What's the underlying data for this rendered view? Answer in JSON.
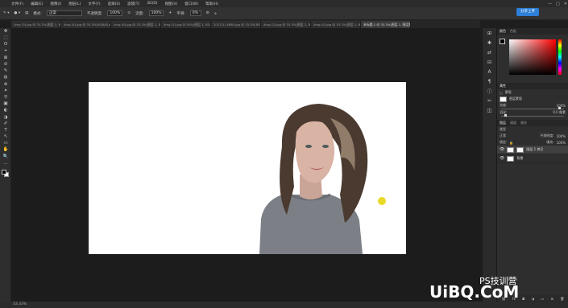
{
  "app": {
    "logo_text": "Ps"
  },
  "menubar": {
    "items": [
      "文件(F)",
      "编辑(E)",
      "图像(I)",
      "图层(L)",
      "文字(Y)",
      "选择(S)",
      "滤镜(T)",
      "3D(D)",
      "视图(V)",
      "窗口(W)",
      "帮助(H)"
    ]
  },
  "share_button": {
    "label": "分享上传"
  },
  "window_controls": [
    "—",
    "□",
    "✕"
  ],
  "optionsbar": {
    "mode_label": "模式:",
    "mode_value": "正常",
    "opacity_label": "不透明度:",
    "opacity_value": "100%",
    "flow_label": "流量:",
    "flow_value": "100%",
    "smooth_label": "平滑:",
    "smooth_value": "0%"
  },
  "tabs": [
    {
      "label": "4mg (3).jpg @ 33.3%(图层 1, RGB/8)",
      "active": false
    },
    {
      "label": "4mg (4).jpg @ 33.3%(RGB/8)",
      "active": false
    },
    {
      "label": "4mg (6).jpg @ 33.3%(图层 1, RGB/8)",
      "active": false
    },
    {
      "label": "4mg (1).jpg @ 50%(图层 1, RGB/8)",
      "active": false
    },
    {
      "label": "2017(1) 4680.jpg @ 33.3%(RGB/8)",
      "active": false
    },
    {
      "label": "4mg (2).jpg @ 33.3%(图层 1, RGB/8)",
      "active": false
    },
    {
      "label": "4mg (5).jpg @ 33.3%(图层 1, RGB/8)",
      "active": false
    },
    {
      "label": "未标题-1 @ 33.3%(图层 1, 图层蒙版/8)",
      "active": true
    }
  ],
  "tools": [
    "✥",
    "⬚",
    "ʘ",
    "⌖",
    "⊠",
    "⊘",
    "✎",
    "◍",
    "⊕",
    "✦",
    "⚲",
    "▣",
    "◐",
    "◑",
    "✐",
    "T",
    "↖",
    "▭",
    "✋",
    "🔍",
    "…"
  ],
  "color_panel": {
    "tabs": [
      "颜色",
      "色板"
    ]
  },
  "adjust_panel": {
    "tabs": [
      "属性"
    ],
    "row1": "蒙版",
    "row2": "图层蒙版",
    "density_label": "浓度:",
    "density_value": "100%",
    "feather_label": "羽化:",
    "feather_value": "0.0 像素"
  },
  "layers_panel": {
    "tabs": [
      "图层",
      "通道",
      "路径"
    ],
    "kind_label": "类型",
    "blend_mode": "正常",
    "opacity_label": "不透明度:",
    "opacity_value": "100%",
    "lock_label": "锁定:",
    "fill_label": "填充:",
    "fill_value": "100%",
    "layers": [
      {
        "name": "图层 1 拷贝",
        "selected": true
      },
      {
        "name": "背景",
        "selected": false
      }
    ]
  },
  "statusbar": {
    "zoom": "33.33%"
  },
  "watermark": {
    "text1": "PS技训营",
    "text2": "UiBQ.CoM"
  },
  "colors": {
    "accent": "#2d7fd8",
    "panel": "#2e2e2e",
    "canvas_bg": "#1c1c1c"
  }
}
